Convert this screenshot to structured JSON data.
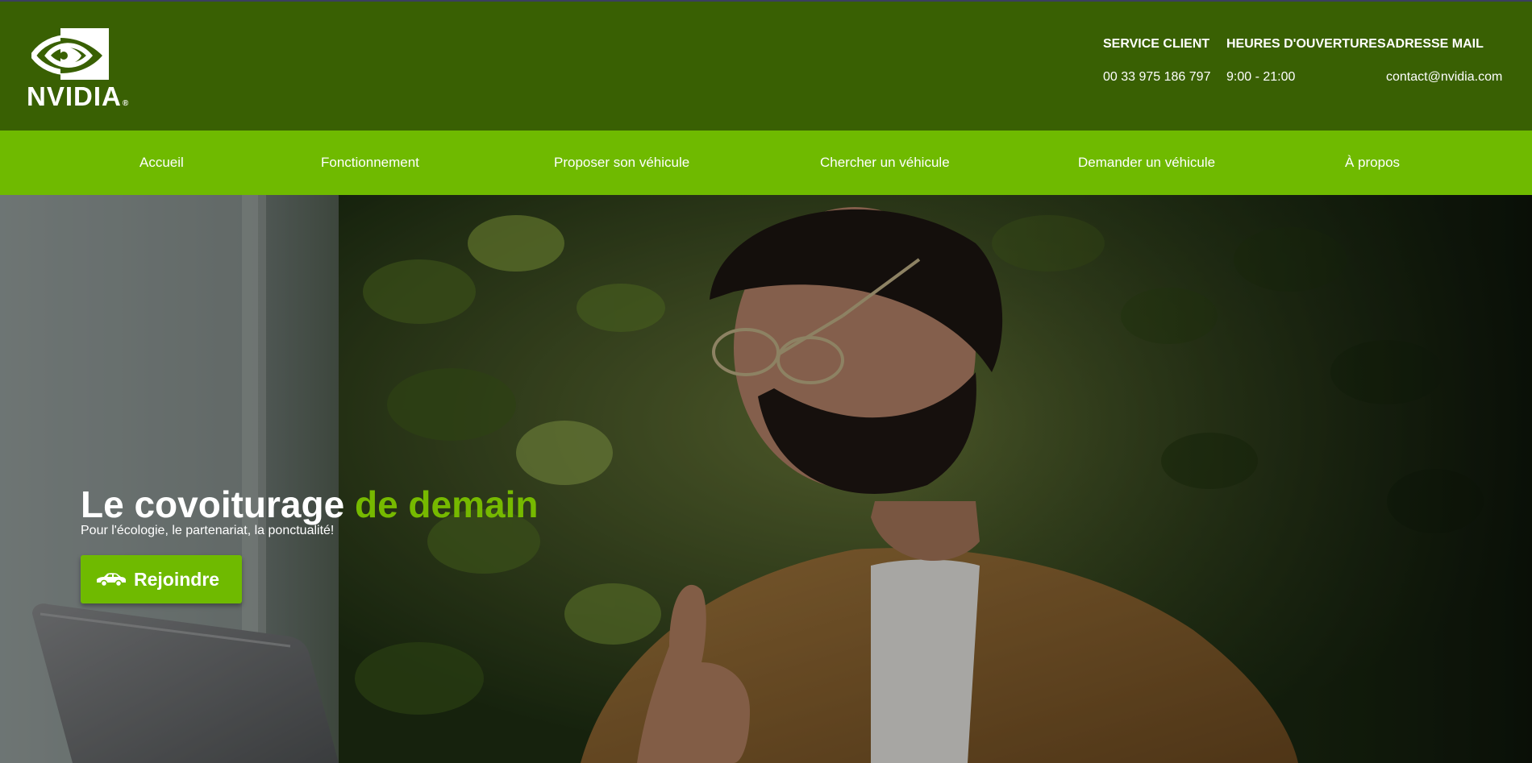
{
  "brand": {
    "name": "NVIDIA",
    "reg_mark": "®",
    "logo_icon": "nvidia-eye-logo"
  },
  "header": {
    "contacts": [
      {
        "title": "SERVICE CLIENT",
        "value": "00 33 975 186 797"
      },
      {
        "title": "HEURES D'OUVERTURES",
        "value": "9:00 - 21:00"
      },
      {
        "title": "ADRESSE MAIL",
        "value": "contact@nvidia.com"
      }
    ]
  },
  "nav": {
    "items": [
      {
        "label": "Accueil"
      },
      {
        "label": "Fonctionnement"
      },
      {
        "label": "Proposer son véhicule"
      },
      {
        "label": "Chercher un véhicule"
      },
      {
        "label": "Demander un véhicule"
      },
      {
        "label": "À propos"
      }
    ]
  },
  "hero": {
    "title_main": "Le covoiturage ",
    "title_accent": "de demain",
    "subtitle": "Pour l'écologie, le partenariat, la ponctualité!",
    "button_label": "Rejoindre",
    "button_icon": "car-icon",
    "background": "photo-man-laptop-thumbs-up-plants"
  },
  "colors": {
    "header_bg": "#396003",
    "nav_bg": "#6fba00",
    "accent": "#76b900",
    "text": "#ffffff"
  }
}
